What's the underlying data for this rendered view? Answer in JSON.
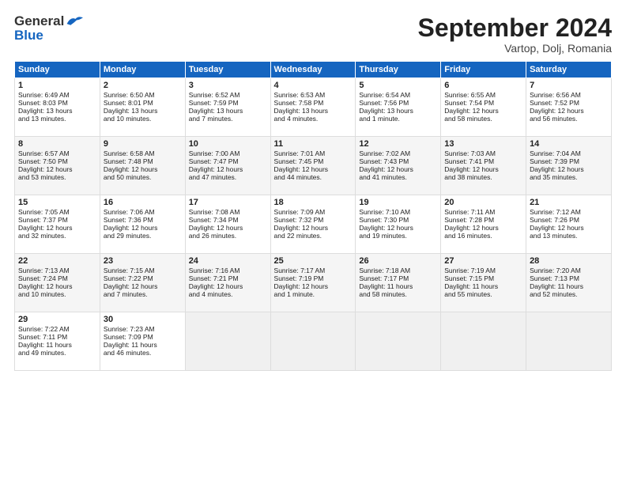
{
  "header": {
    "logo_general": "General",
    "logo_blue": "Blue",
    "month": "September 2024",
    "location": "Vartop, Dolj, Romania"
  },
  "days_of_week": [
    "Sunday",
    "Monday",
    "Tuesday",
    "Wednesday",
    "Thursday",
    "Friday",
    "Saturday"
  ],
  "weeks": [
    [
      {
        "day": "1",
        "lines": [
          "Sunrise: 6:49 AM",
          "Sunset: 8:03 PM",
          "Daylight: 13 hours",
          "and 13 minutes."
        ]
      },
      {
        "day": "2",
        "lines": [
          "Sunrise: 6:50 AM",
          "Sunset: 8:01 PM",
          "Daylight: 13 hours",
          "and 10 minutes."
        ]
      },
      {
        "day": "3",
        "lines": [
          "Sunrise: 6:52 AM",
          "Sunset: 7:59 PM",
          "Daylight: 13 hours",
          "and 7 minutes."
        ]
      },
      {
        "day": "4",
        "lines": [
          "Sunrise: 6:53 AM",
          "Sunset: 7:58 PM",
          "Daylight: 13 hours",
          "and 4 minutes."
        ]
      },
      {
        "day": "5",
        "lines": [
          "Sunrise: 6:54 AM",
          "Sunset: 7:56 PM",
          "Daylight: 13 hours",
          "and 1 minute."
        ]
      },
      {
        "day": "6",
        "lines": [
          "Sunrise: 6:55 AM",
          "Sunset: 7:54 PM",
          "Daylight: 12 hours",
          "and 58 minutes."
        ]
      },
      {
        "day": "7",
        "lines": [
          "Sunrise: 6:56 AM",
          "Sunset: 7:52 PM",
          "Daylight: 12 hours",
          "and 56 minutes."
        ]
      }
    ],
    [
      {
        "day": "8",
        "lines": [
          "Sunrise: 6:57 AM",
          "Sunset: 7:50 PM",
          "Daylight: 12 hours",
          "and 53 minutes."
        ]
      },
      {
        "day": "9",
        "lines": [
          "Sunrise: 6:58 AM",
          "Sunset: 7:48 PM",
          "Daylight: 12 hours",
          "and 50 minutes."
        ]
      },
      {
        "day": "10",
        "lines": [
          "Sunrise: 7:00 AM",
          "Sunset: 7:47 PM",
          "Daylight: 12 hours",
          "and 47 minutes."
        ]
      },
      {
        "day": "11",
        "lines": [
          "Sunrise: 7:01 AM",
          "Sunset: 7:45 PM",
          "Daylight: 12 hours",
          "and 44 minutes."
        ]
      },
      {
        "day": "12",
        "lines": [
          "Sunrise: 7:02 AM",
          "Sunset: 7:43 PM",
          "Daylight: 12 hours",
          "and 41 minutes."
        ]
      },
      {
        "day": "13",
        "lines": [
          "Sunrise: 7:03 AM",
          "Sunset: 7:41 PM",
          "Daylight: 12 hours",
          "and 38 minutes."
        ]
      },
      {
        "day": "14",
        "lines": [
          "Sunrise: 7:04 AM",
          "Sunset: 7:39 PM",
          "Daylight: 12 hours",
          "and 35 minutes."
        ]
      }
    ],
    [
      {
        "day": "15",
        "lines": [
          "Sunrise: 7:05 AM",
          "Sunset: 7:37 PM",
          "Daylight: 12 hours",
          "and 32 minutes."
        ]
      },
      {
        "day": "16",
        "lines": [
          "Sunrise: 7:06 AM",
          "Sunset: 7:36 PM",
          "Daylight: 12 hours",
          "and 29 minutes."
        ]
      },
      {
        "day": "17",
        "lines": [
          "Sunrise: 7:08 AM",
          "Sunset: 7:34 PM",
          "Daylight: 12 hours",
          "and 26 minutes."
        ]
      },
      {
        "day": "18",
        "lines": [
          "Sunrise: 7:09 AM",
          "Sunset: 7:32 PM",
          "Daylight: 12 hours",
          "and 22 minutes."
        ]
      },
      {
        "day": "19",
        "lines": [
          "Sunrise: 7:10 AM",
          "Sunset: 7:30 PM",
          "Daylight: 12 hours",
          "and 19 minutes."
        ]
      },
      {
        "day": "20",
        "lines": [
          "Sunrise: 7:11 AM",
          "Sunset: 7:28 PM",
          "Daylight: 12 hours",
          "and 16 minutes."
        ]
      },
      {
        "day": "21",
        "lines": [
          "Sunrise: 7:12 AM",
          "Sunset: 7:26 PM",
          "Daylight: 12 hours",
          "and 13 minutes."
        ]
      }
    ],
    [
      {
        "day": "22",
        "lines": [
          "Sunrise: 7:13 AM",
          "Sunset: 7:24 PM",
          "Daylight: 12 hours",
          "and 10 minutes."
        ]
      },
      {
        "day": "23",
        "lines": [
          "Sunrise: 7:15 AM",
          "Sunset: 7:22 PM",
          "Daylight: 12 hours",
          "and 7 minutes."
        ]
      },
      {
        "day": "24",
        "lines": [
          "Sunrise: 7:16 AM",
          "Sunset: 7:21 PM",
          "Daylight: 12 hours",
          "and 4 minutes."
        ]
      },
      {
        "day": "25",
        "lines": [
          "Sunrise: 7:17 AM",
          "Sunset: 7:19 PM",
          "Daylight: 12 hours",
          "and 1 minute."
        ]
      },
      {
        "day": "26",
        "lines": [
          "Sunrise: 7:18 AM",
          "Sunset: 7:17 PM",
          "Daylight: 11 hours",
          "and 58 minutes."
        ]
      },
      {
        "day": "27",
        "lines": [
          "Sunrise: 7:19 AM",
          "Sunset: 7:15 PM",
          "Daylight: 11 hours",
          "and 55 minutes."
        ]
      },
      {
        "day": "28",
        "lines": [
          "Sunrise: 7:20 AM",
          "Sunset: 7:13 PM",
          "Daylight: 11 hours",
          "and 52 minutes."
        ]
      }
    ],
    [
      {
        "day": "29",
        "lines": [
          "Sunrise: 7:22 AM",
          "Sunset: 7:11 PM",
          "Daylight: 11 hours",
          "and 49 minutes."
        ]
      },
      {
        "day": "30",
        "lines": [
          "Sunrise: 7:23 AM",
          "Sunset: 7:09 PM",
          "Daylight: 11 hours",
          "and 46 minutes."
        ]
      },
      {
        "day": "",
        "lines": []
      },
      {
        "day": "",
        "lines": []
      },
      {
        "day": "",
        "lines": []
      },
      {
        "day": "",
        "lines": []
      },
      {
        "day": "",
        "lines": []
      }
    ]
  ]
}
